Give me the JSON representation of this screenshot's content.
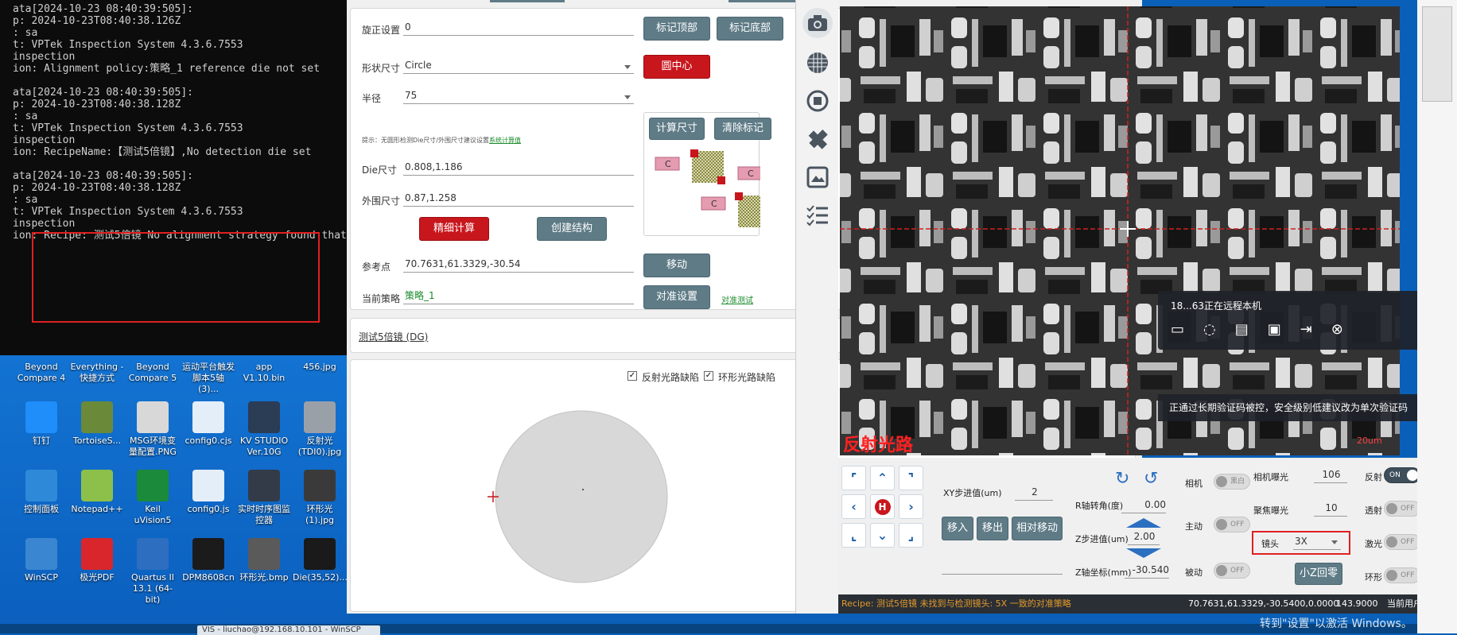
{
  "console": {
    "lines": [
      "ata[2024-10-23 08:40:39:505]:",
      "p: 2024-10-23T08:40:38.126Z",
      ": sa",
      "t: VPTek Inspection System 4.3.6.7553",
      "inspection",
      "ion: Alignment policy:策略_1 reference die not set",
      "",
      "ata[2024-10-23 08:40:39:505]:",
      "p: 2024-10-23T08:40:38.128Z",
      ": sa",
      "t: VPTek Inspection System 4.3.6.7553",
      "inspection",
      "ion: RecipeName:【测试5倍镜】,No detection die set",
      "",
      "ata[2024-10-23 08:40:39:505]:",
      "p: 2024-10-23T08:40:38.128Z",
      ": sa",
      "t: VPTek Inspection System 4.3.6.7553",
      "inspection",
      "ion: Recipe: 测试5倍镜 No alignment strategy found that"
    ]
  },
  "desktop": {
    "icons": [
      {
        "label": "Beyond Compare 4",
        "icon": "beyond-compare-icon",
        "color": "#1a7ad4"
      },
      {
        "label": "Everything - 快捷方式",
        "icon": "search-icon",
        "color": "#1a7ad4"
      },
      {
        "label": "Beyond Compare 5",
        "icon": "beyond-compare-icon",
        "color": "#1a7ad4"
      },
      {
        "label": "运动平台触发脚本5轴 (3)...",
        "icon": "text-file-icon",
        "color": "#1a7ad4"
      },
      {
        "label": "app V1.10.bin",
        "icon": "binary-file-icon",
        "color": "#1a7ad4"
      },
      {
        "label": "456.jpg",
        "icon": "image-file-icon",
        "color": "#1a7ad4"
      },
      {
        "label": "钉钉",
        "icon": "dingtalk-icon",
        "color": "#1f8dfa"
      },
      {
        "label": "TortoiseS...",
        "icon": "tortoise-icon",
        "color": "#6a8a3a"
      },
      {
        "label": "MSG环境变量配置.PNG",
        "icon": "image-file-icon",
        "color": "#d8d8d8"
      },
      {
        "label": "config0.cjs",
        "icon": "script-file-icon",
        "color": "#e4eef8"
      },
      {
        "label": "KV STUDIO Ver.10G",
        "icon": "kv-studio-icon",
        "color": "#2b3c55"
      },
      {
        "label": "反射光 (TDI0).jpg",
        "icon": "image-file-icon",
        "color": "#9aa0a8"
      },
      {
        "label": "控制面板",
        "icon": "control-panel-icon",
        "color": "#2e8ad8"
      },
      {
        "label": "Notepad++",
        "icon": "notepad-icon",
        "color": "#8cc04a"
      },
      {
        "label": "Keil uVision5",
        "icon": "keil-icon",
        "color": "#1b8a3a"
      },
      {
        "label": "config0.js",
        "icon": "script-file-icon",
        "color": "#e4eef8"
      },
      {
        "label": "实时时序图监控器",
        "icon": "monitor-icon",
        "color": "#333b48"
      },
      {
        "label": "环形光 (1).jpg",
        "icon": "image-file-icon",
        "color": "#3a3a3a"
      },
      {
        "label": "WinSCP",
        "icon": "winscp-icon",
        "color": "#3a86d0"
      },
      {
        "label": "极光PDF",
        "icon": "pdf-icon",
        "color": "#d8262c"
      },
      {
        "label": "Quartus II 13.1 (64-bit)",
        "icon": "quartus-icon",
        "color": "#2d6ec0"
      },
      {
        "label": "DPM8608cn",
        "icon": "device-icon",
        "color": "#1b1b1b"
      },
      {
        "label": "环形光.bmp",
        "icon": "image-file-icon",
        "color": "#5a5a5a"
      },
      {
        "label": "Die(35,52)...",
        "icon": "image-file-icon",
        "color": "#1a1a1a"
      }
    ]
  },
  "taskbar": {
    "item": "VIS - liuchao@192.168.10.101 - WinSCP"
  },
  "app": {
    "form": {
      "rotation_label": "旋正设置",
      "rotation_value": "0",
      "mark_top": "标记顶部",
      "mark_bottom": "标记底部",
      "shape_label": "形状尺寸",
      "shape_value": "Circle",
      "center_btn": "圆中心",
      "radius_label": "半径",
      "radius_value": "75",
      "hint": "提示：无圆形检测Die尺寸/外围尺寸建议设置",
      "hint_link": "系统计算值",
      "calc_size": "计算尺寸",
      "clear_marks": "清除标记",
      "die_label": "Die尺寸",
      "die_value": "0.808,1.186",
      "outer_label": "外围尺寸",
      "outer_value": "0.87,1.258",
      "fine_calc": "精细计算",
      "create_structure": "创建结构",
      "ref_label": "参考点",
      "ref_value": "70.7631,61.3329,-30.54",
      "move_btn": "移动",
      "strategy_label": "当前策略",
      "strategy_value": "策略_1",
      "align_btn": "对准设置",
      "align_test": "对准测试",
      "diagram_marker": "C"
    },
    "recipe": {
      "link": "测试5倍镜 (DG)"
    },
    "wafer": {
      "reflect_defect": "反射光路缺陷",
      "ring_defect": "环形光路缺陷"
    },
    "camera": {
      "path_label": "反射光路",
      "zoom_hint": "20um",
      "remote_title": "18...63正在远程本机",
      "notice": "正通过长期验证码被控，安全级别低建议改为单次验证码"
    },
    "controls": {
      "xy_step_label": "XY步进值(um)",
      "xy_step_value": "2",
      "move_in": "移入",
      "move_out": "移出",
      "rel_move": "相对移动",
      "r_angle_label": "R轴转角(度)",
      "r_angle_value": "0.00",
      "z_step_label": "Z步进值(um)",
      "z_step_value": "2.00",
      "z_coord_label": "Z轴坐标(mm)",
      "z_coord_value": "-30.540",
      "camera_label": "相机",
      "camera_toggle": "黑白",
      "active_label": "主动",
      "active_toggle": "OFF",
      "passive_label": "被动",
      "passive_toggle": "OFF",
      "cam_exposure_label": "相机曝光",
      "cam_exposure_value": "106",
      "focus_exposure_label": "聚焦曝光",
      "focus_exposure_value": "10",
      "lens_label": "镜头",
      "lens_value": "3X",
      "small_z_btn": "小Z回零",
      "reflect_label": "反射",
      "reflect_toggle": "ON",
      "trans_label": "透射",
      "trans_toggle": "OFF",
      "laser_label": "激光",
      "laser_toggle": "OFF",
      "ring_label": "环形",
      "ring_toggle": "OFF",
      "home_label": "H"
    },
    "status": {
      "message": "Recipe: 测试5倍镜 未找到与检测镜头: 5X 一致的对准策略",
      "coords": "70.7631,61.3329,-30.5400,0.0000",
      "angle": "143.9000",
      "user": "当前用户"
    },
    "windows_activate": "转到\"设置\"以激活 Windows。"
  }
}
